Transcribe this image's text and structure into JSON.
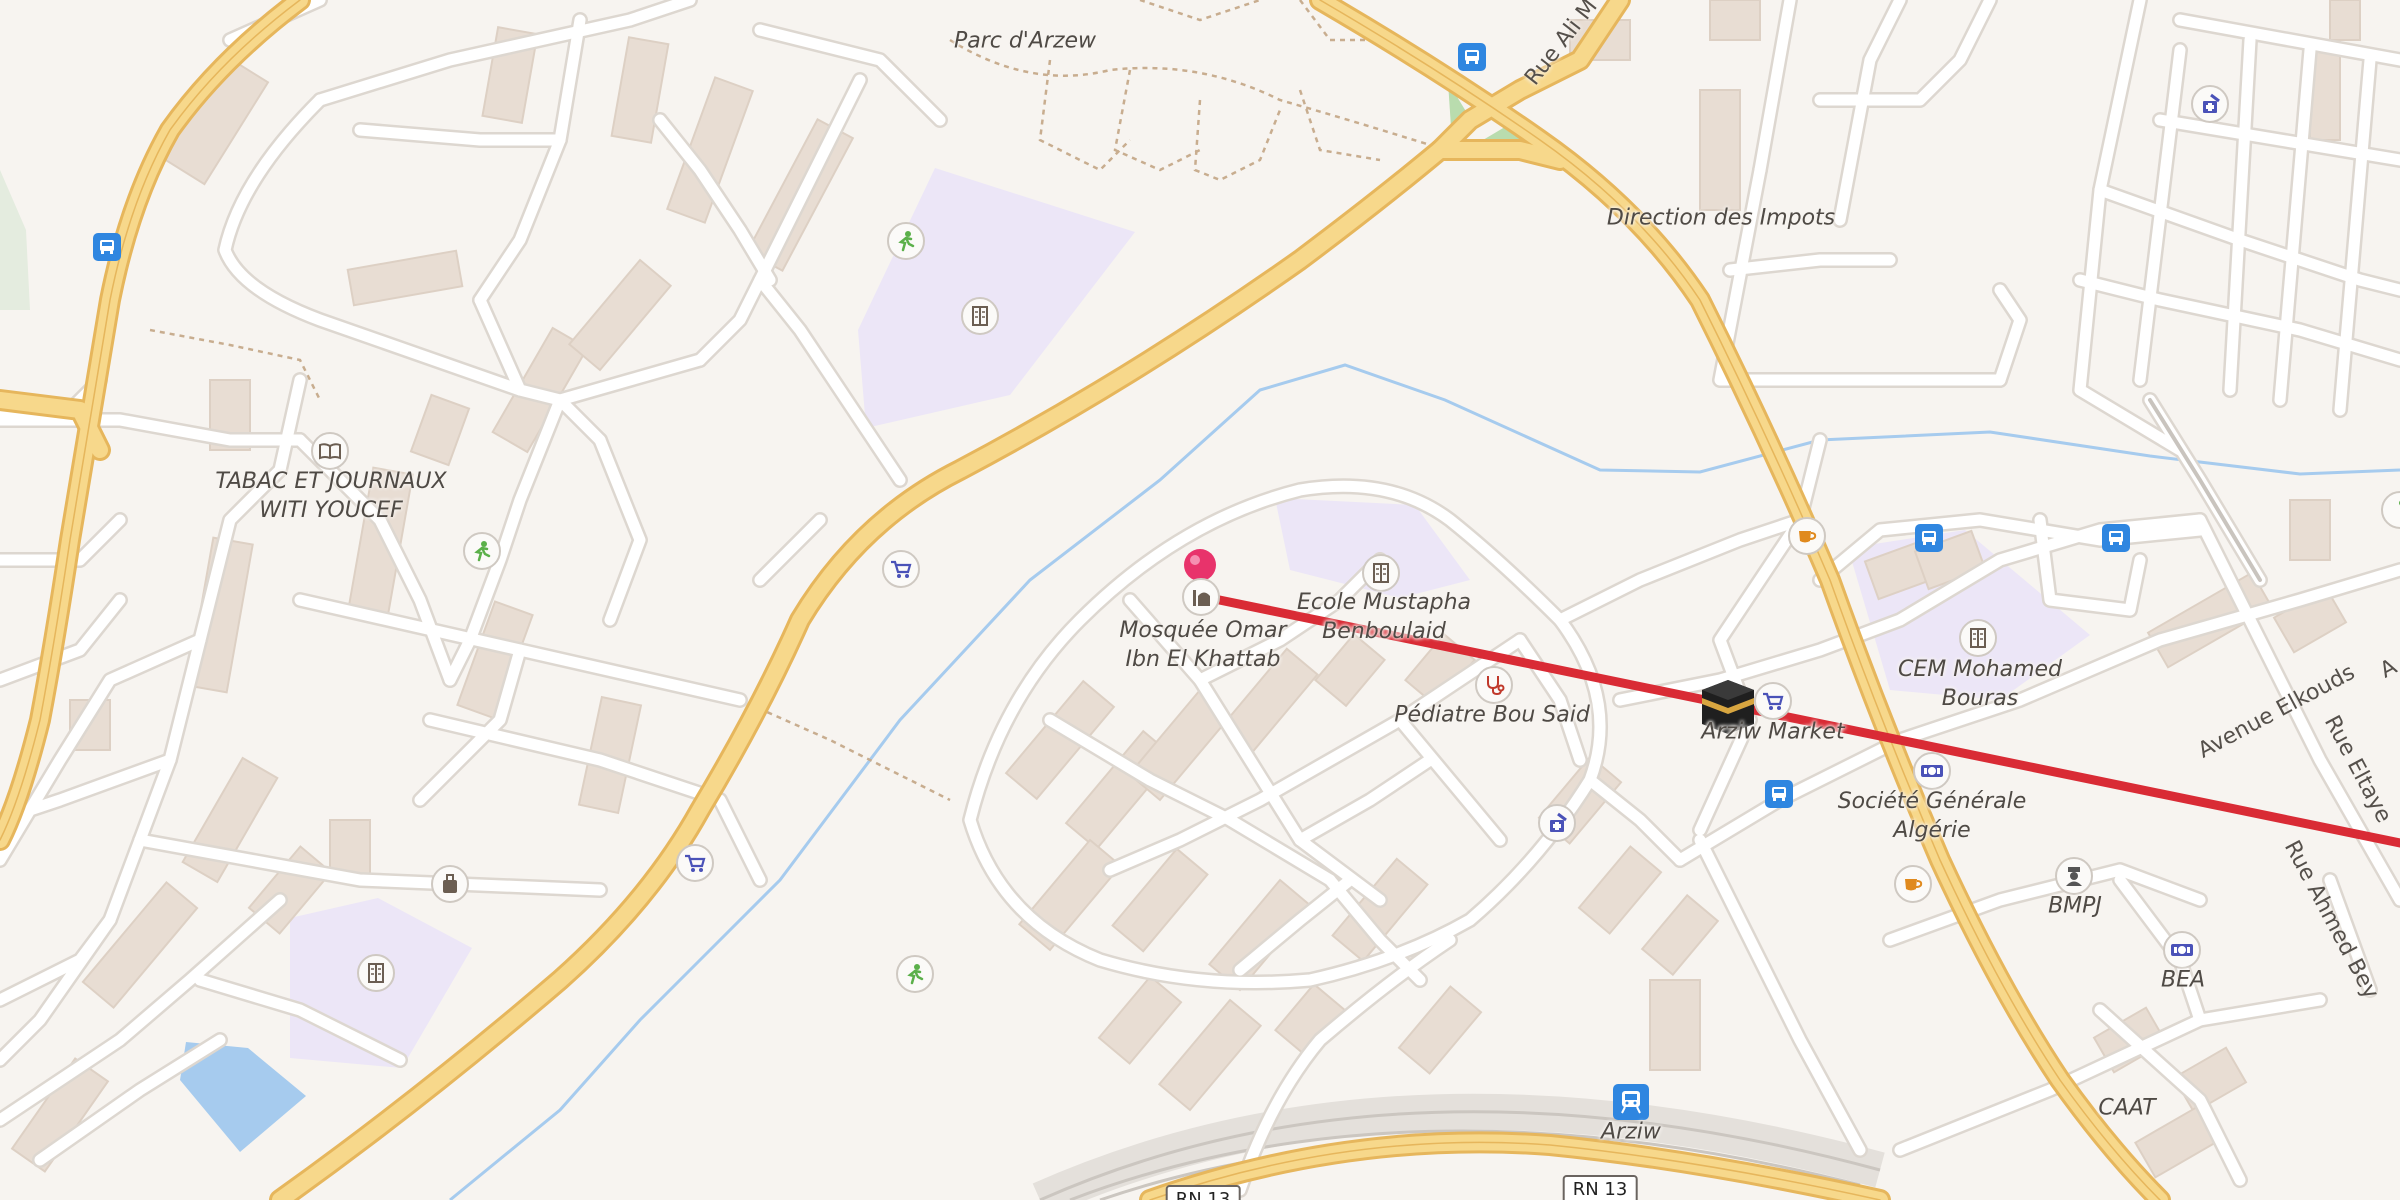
{
  "map": {
    "colors": {
      "background": "#f7f4f0",
      "building": "#e8ddd3",
      "school_area": "#ece6f7",
      "major_road": "#f7d88b",
      "major_road_casing": "#e6b65c",
      "minor_road": "#ffffff",
      "minor_road_casing": "#ddd7d0",
      "water": "#a6cbee",
      "route_line": "#d92b35",
      "pin": "#e8336b",
      "bus_stop": "#2f86e0",
      "pitch": "#b9dcae"
    },
    "place_labels": {
      "parc": "Parc d'Arzew",
      "direction_impots": "Direction des Impots",
      "tabac_line1": "TABAC ET JOURNAUX",
      "tabac_line2": "WITI YOUCEF",
      "mosquee_line1": "Mosquée Omar",
      "mosquee_line2": "Ibn El Khattab",
      "ecole_line1": "Ecole Mustapha",
      "ecole_line2": "Benboulaid",
      "pediatre": "Pédiatre Bou Said",
      "arziw_market": "Arziw Market",
      "cem_line1": "CEM Mohamed",
      "cem_line2": "Bouras",
      "societe_line1": "Société Générale",
      "societe_line2": "Algérie",
      "bmpj": "BMPJ",
      "bea": "BEA",
      "caat": "CAAT",
      "arziw_station": "Arziw"
    },
    "street_labels": {
      "rue_ali": "Rue Ali M",
      "avenue_elkouds": "Avenue Elkouds",
      "rue_eltayeb": "Rue Eltaye",
      "rue_ahmed": "Rue Ahmed Bey",
      "right_edge": "A"
    },
    "road_shields": {
      "rn13_left": "RN 13",
      "rn13_right": "RN 13"
    },
    "poi_icons": [
      "sport-icon",
      "school-icon",
      "library-icon",
      "shop-icon",
      "mosque-icon",
      "doctor-icon",
      "cafe-icon",
      "bank-icon",
      "police-icon",
      "pharmacy-icon",
      "bus-stop-icon",
      "train-station-icon",
      "kaaba-icon",
      "map-pin-icon"
    ]
  }
}
